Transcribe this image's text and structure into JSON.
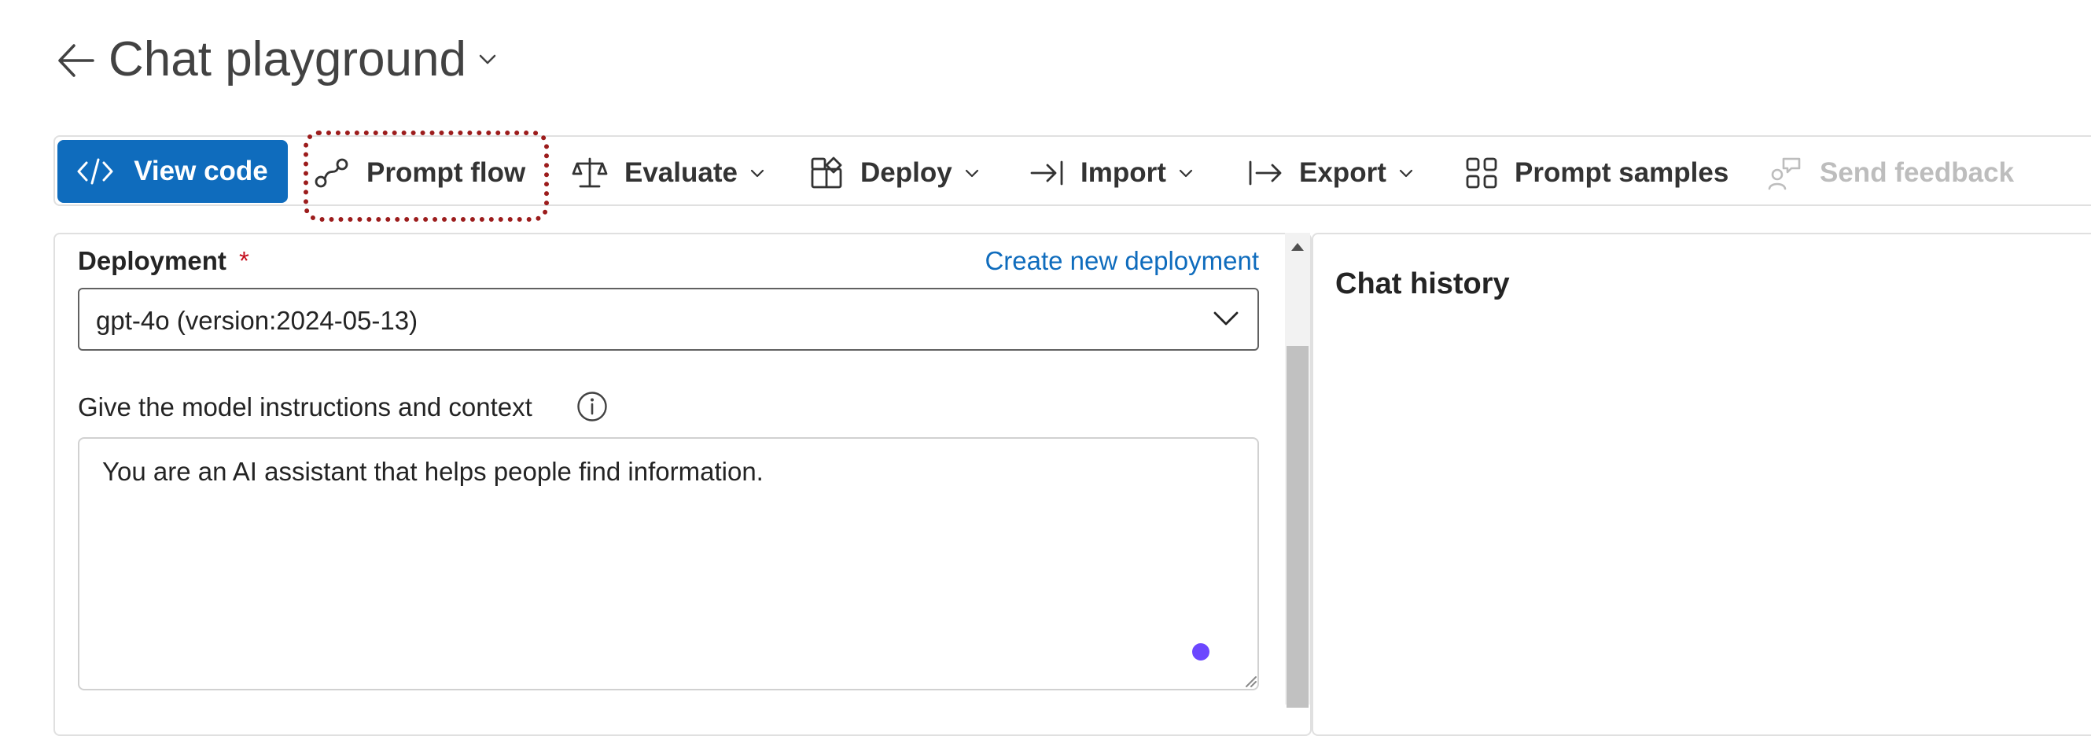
{
  "page": {
    "title": "Chat playground"
  },
  "toolbar": {
    "view_code": "View code",
    "prompt_flow": "Prompt flow",
    "evaluate": "Evaluate",
    "deploy": "Deploy",
    "import": "Import",
    "export": "Export",
    "prompt_samples": "Prompt samples",
    "send_feedback": "Send feedback"
  },
  "setup": {
    "deployment_label": "Deployment",
    "required_marker": "*",
    "create_link": "Create new deployment",
    "deployment_value": "gpt-4o (version:2024-05-13)",
    "instructions_label": "Give the model instructions and context",
    "system_message": "You are an AI assistant that helps people find information."
  },
  "chat": {
    "history_title": "Chat history"
  },
  "colors": {
    "primary": "#0f6cbd",
    "highlight_border": "#9c1c1c",
    "required": "#c50f1f",
    "status_dot": "#6c47ff",
    "disabled_text": "#bdbdbd"
  }
}
